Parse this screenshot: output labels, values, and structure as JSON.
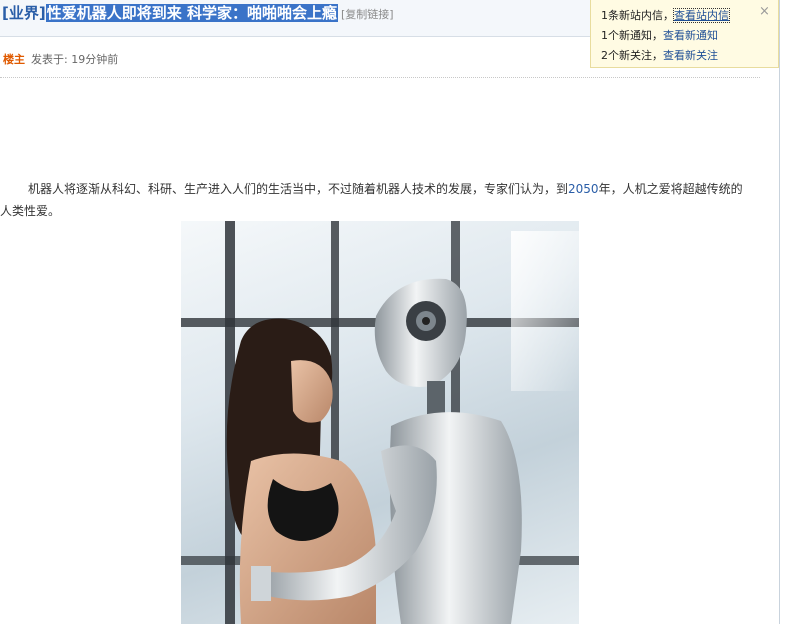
{
  "post": {
    "category": "[业界]",
    "title": "性爱机器人即将到来 科学家：啪啪啪会上瘾",
    "copy_link": "[复制链接]",
    "author_badge": "楼主",
    "posted_time": "发表于: 19分钟前",
    "body_before_year": "机器人将逐渐从科幻、科研、生产进入人们的生活当中，不过随着机器人技术的发展，专家们认为，到",
    "body_year": "2050",
    "body_after_year": "年，人机之爱将超越传统的人类性爱。"
  },
  "notifications": {
    "messages_text": "1条新站内信，",
    "messages_link": "查看站内信",
    "notices_text": "1个新通知，",
    "notices_link": "查看新通知",
    "follows_text": "2个新关注，",
    "follows_link": "查看新关注",
    "close_glyph": "×"
  },
  "colors": {
    "link_blue": "#2a5ea8",
    "title_highlight": "#3a73c8",
    "author_orange": "#e05a00",
    "popup_bg": "#fffbe3"
  }
}
